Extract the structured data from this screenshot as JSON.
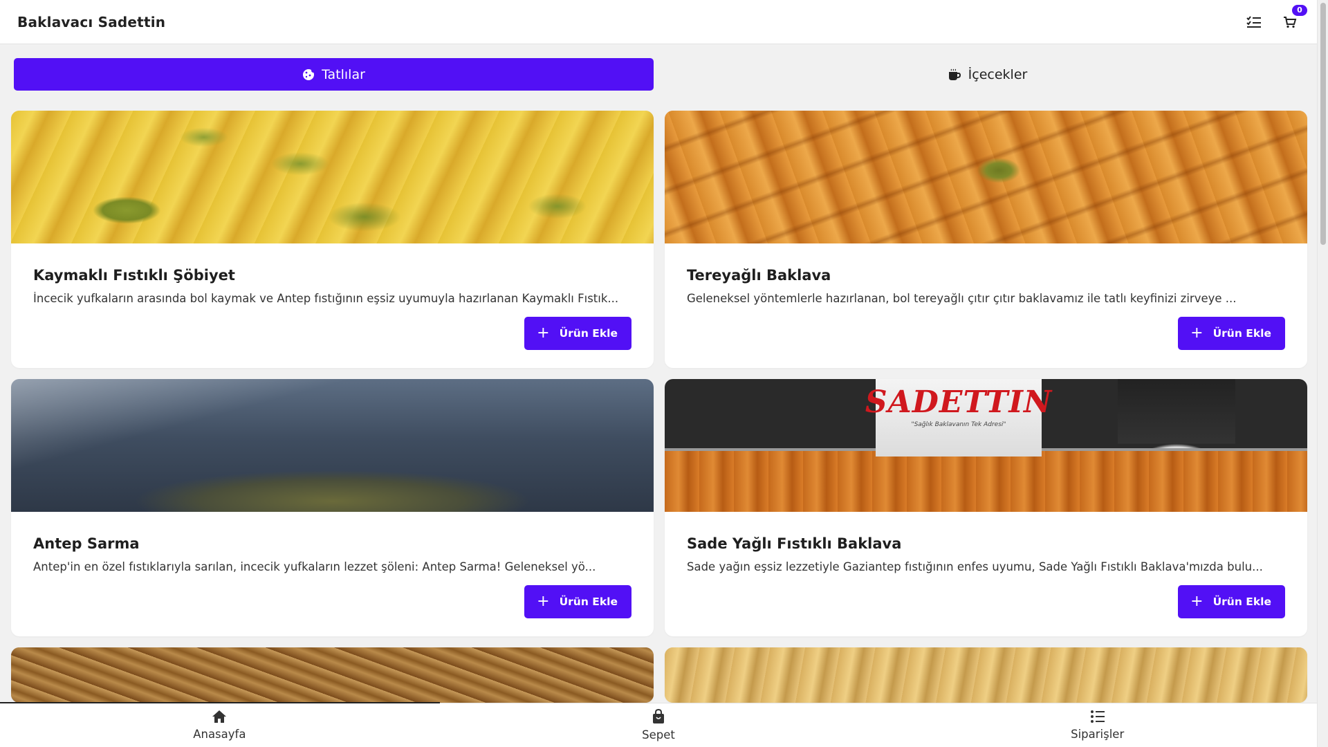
{
  "header": {
    "title": "Baklavacı Sadettin",
    "orders_icon": "checklist-icon",
    "cart_icon": "cart-icon",
    "cart_count": "0"
  },
  "tabs": [
    {
      "label": "Tatlılar",
      "icon": "cookie-icon",
      "active": true
    },
    {
      "label": "İçecekler",
      "icon": "mug-icon",
      "active": false
    }
  ],
  "products": [
    {
      "title": "Kaymaklı Fıstıklı Şöbiyet",
      "description": "İncecik yufkaların arasında bol kaymak ve Antep fıstığının eşsiz uyumuyla hazırlanan Kaymaklı Fıstık...",
      "button_label": "Ürün Ekle"
    },
    {
      "title": "Tereyağlı Baklava",
      "description": "Geleneksel yöntemlerle hazırlanan, bol tereyağlı çıtır çıtır baklavamız ile tatlı keyfinizi zirveye ...",
      "button_label": "Ürün Ekle"
    },
    {
      "title": "Antep Sarma",
      "description": "Antep'in en özel fıstıklarıyla sarılan, incecik yufkaların lezzet şöleni: Antep Sarma! Geleneksel yö...",
      "button_label": "Ürün Ekle"
    },
    {
      "title": "Sade Yağlı Fıstıklı Baklava",
      "description": "Sade yağın eşsiz lezzetiyle Gaziantep fıstığının enfes uyumu, Sade Yağlı Fıstıklı Baklava'mızda bulu...",
      "button_label": "Ürün Ekle",
      "image_text": {
        "logo": "SADETTIN",
        "slogan": "\"Sağlık Baklavanın Tek Adresi\""
      }
    }
  ],
  "bottom_nav": [
    {
      "label": "Anasayfa",
      "icon": "home-icon"
    },
    {
      "label": "Sepet",
      "icon": "shopping-bag-icon"
    },
    {
      "label": "Siparişler",
      "icon": "list-icon"
    }
  ],
  "colors": {
    "accent": "#5210f5",
    "background": "#f1f1f1",
    "card": "#ffffff"
  }
}
